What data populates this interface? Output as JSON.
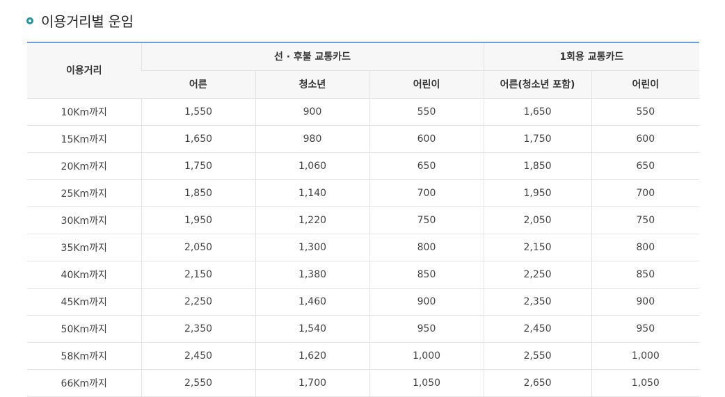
{
  "section": {
    "title": "이용거리별 운임",
    "icon": "bullet-ring-icon",
    "accent_color": "#1f93a8"
  },
  "table": {
    "header_distance": "이용거리",
    "group_prepaid": "선 · 후불 교통카드",
    "group_single": "1회용 교통카드",
    "columns": [
      "어른",
      "청소년",
      "어린이",
      "어른(청소년 포함)",
      "어린이"
    ],
    "rows": [
      {
        "distance": "10Km까지",
        "prepaid_adult": "1,550",
        "prepaid_youth": "900",
        "prepaid_child": "550",
        "single_adult": "1,650",
        "single_child": "550"
      },
      {
        "distance": "15Km까지",
        "prepaid_adult": "1,650",
        "prepaid_youth": "980",
        "prepaid_child": "600",
        "single_adult": "1,750",
        "single_child": "600"
      },
      {
        "distance": "20Km까지",
        "prepaid_adult": "1,750",
        "prepaid_youth": "1,060",
        "prepaid_child": "650",
        "single_adult": "1,850",
        "single_child": "650"
      },
      {
        "distance": "25Km까지",
        "prepaid_adult": "1,850",
        "prepaid_youth": "1,140",
        "prepaid_child": "700",
        "single_adult": "1,950",
        "single_child": "700"
      },
      {
        "distance": "30Km까지",
        "prepaid_adult": "1,950",
        "prepaid_youth": "1,220",
        "prepaid_child": "750",
        "single_adult": "2,050",
        "single_child": "750"
      },
      {
        "distance": "35Km까지",
        "prepaid_adult": "2,050",
        "prepaid_youth": "1,300",
        "prepaid_child": "800",
        "single_adult": "2,150",
        "single_child": "800"
      },
      {
        "distance": "40Km까지",
        "prepaid_adult": "2,150",
        "prepaid_youth": "1,380",
        "prepaid_child": "850",
        "single_adult": "2,250",
        "single_child": "850"
      },
      {
        "distance": "45Km까지",
        "prepaid_adult": "2,250",
        "prepaid_youth": "1,460",
        "prepaid_child": "900",
        "single_adult": "2,350",
        "single_child": "900"
      },
      {
        "distance": "50Km까지",
        "prepaid_adult": "2,350",
        "prepaid_youth": "1,540",
        "prepaid_child": "950",
        "single_adult": "2,450",
        "single_child": "950"
      },
      {
        "distance": "58Km까지",
        "prepaid_adult": "2,450",
        "prepaid_youth": "1,620",
        "prepaid_child": "1,000",
        "single_adult": "2,550",
        "single_child": "1,000"
      },
      {
        "distance": "66Km까지",
        "prepaid_adult": "2,550",
        "prepaid_youth": "1,700",
        "prepaid_child": "1,050",
        "single_adult": "2,650",
        "single_child": "1,050"
      }
    ]
  }
}
